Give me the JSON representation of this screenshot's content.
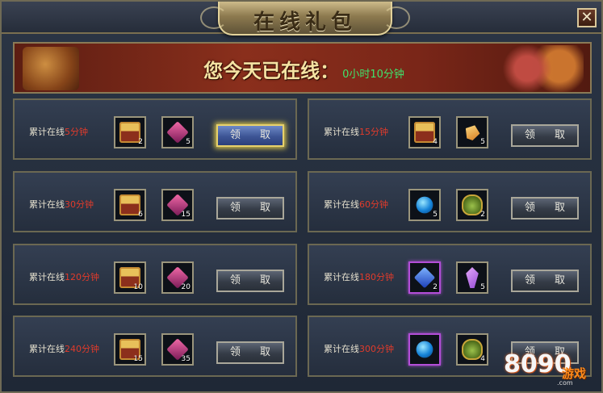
{
  "window": {
    "title": "在线礼包",
    "close_label": "✕"
  },
  "banner": {
    "label": "您今天已在线：",
    "time": "0小时10分钟"
  },
  "button_label": "领 取",
  "rewards_left": [
    {
      "label_prefix": "累计在线",
      "minutes": "5分钟",
      "items": [
        {
          "icon": "treasure-chest-icon",
          "qty": "2"
        },
        {
          "icon": "red-gem-icon",
          "qty": "5"
        }
      ],
      "active": true
    },
    {
      "label_prefix": "累计在线",
      "minutes": "30分钟",
      "items": [
        {
          "icon": "treasure-chest-icon",
          "qty": "6"
        },
        {
          "icon": "red-gem-icon",
          "qty": "15"
        }
      ],
      "active": false
    },
    {
      "label_prefix": "累计在线",
      "minutes": "120分钟",
      "items": [
        {
          "icon": "treasure-chest-icon",
          "qty": "10"
        },
        {
          "icon": "red-gem-icon",
          "qty": "20"
        }
      ],
      "active": false
    },
    {
      "label_prefix": "累计在线",
      "minutes": "240分钟",
      "items": [
        {
          "icon": "treasure-chest-icon",
          "qty": "15"
        },
        {
          "icon": "red-gem-icon",
          "qty": "35"
        }
      ],
      "active": false
    }
  ],
  "rewards_right": [
    {
      "label_prefix": "累计在线",
      "minutes": "15分钟",
      "items": [
        {
          "icon": "treasure-chest-icon",
          "qty": "4"
        },
        {
          "icon": "orange-gem-icon",
          "qty": "5"
        }
      ],
      "active": false
    },
    {
      "label_prefix": "累计在线",
      "minutes": "60分钟",
      "items": [
        {
          "icon": "blue-orb-icon",
          "qty": "5"
        },
        {
          "icon": "green-pouch-icon",
          "qty": "2"
        }
      ],
      "active": false
    },
    {
      "label_prefix": "累计在线",
      "minutes": "180分钟",
      "items": [
        {
          "icon": "blue-gem-icon",
          "qty": "2",
          "rare": true
        },
        {
          "icon": "purple-crystal-icon",
          "qty": "5"
        }
      ],
      "active": false
    },
    {
      "label_prefix": "累计在线",
      "minutes": "300分钟",
      "items": [
        {
          "icon": "blue-orb-icon",
          "qty": "",
          "rare": true
        },
        {
          "icon": "green-pouch-icon",
          "qty": "4"
        }
      ],
      "active": false
    }
  ],
  "watermark": {
    "digits": "8090",
    "text": "游戏",
    "domain": ".com"
  }
}
